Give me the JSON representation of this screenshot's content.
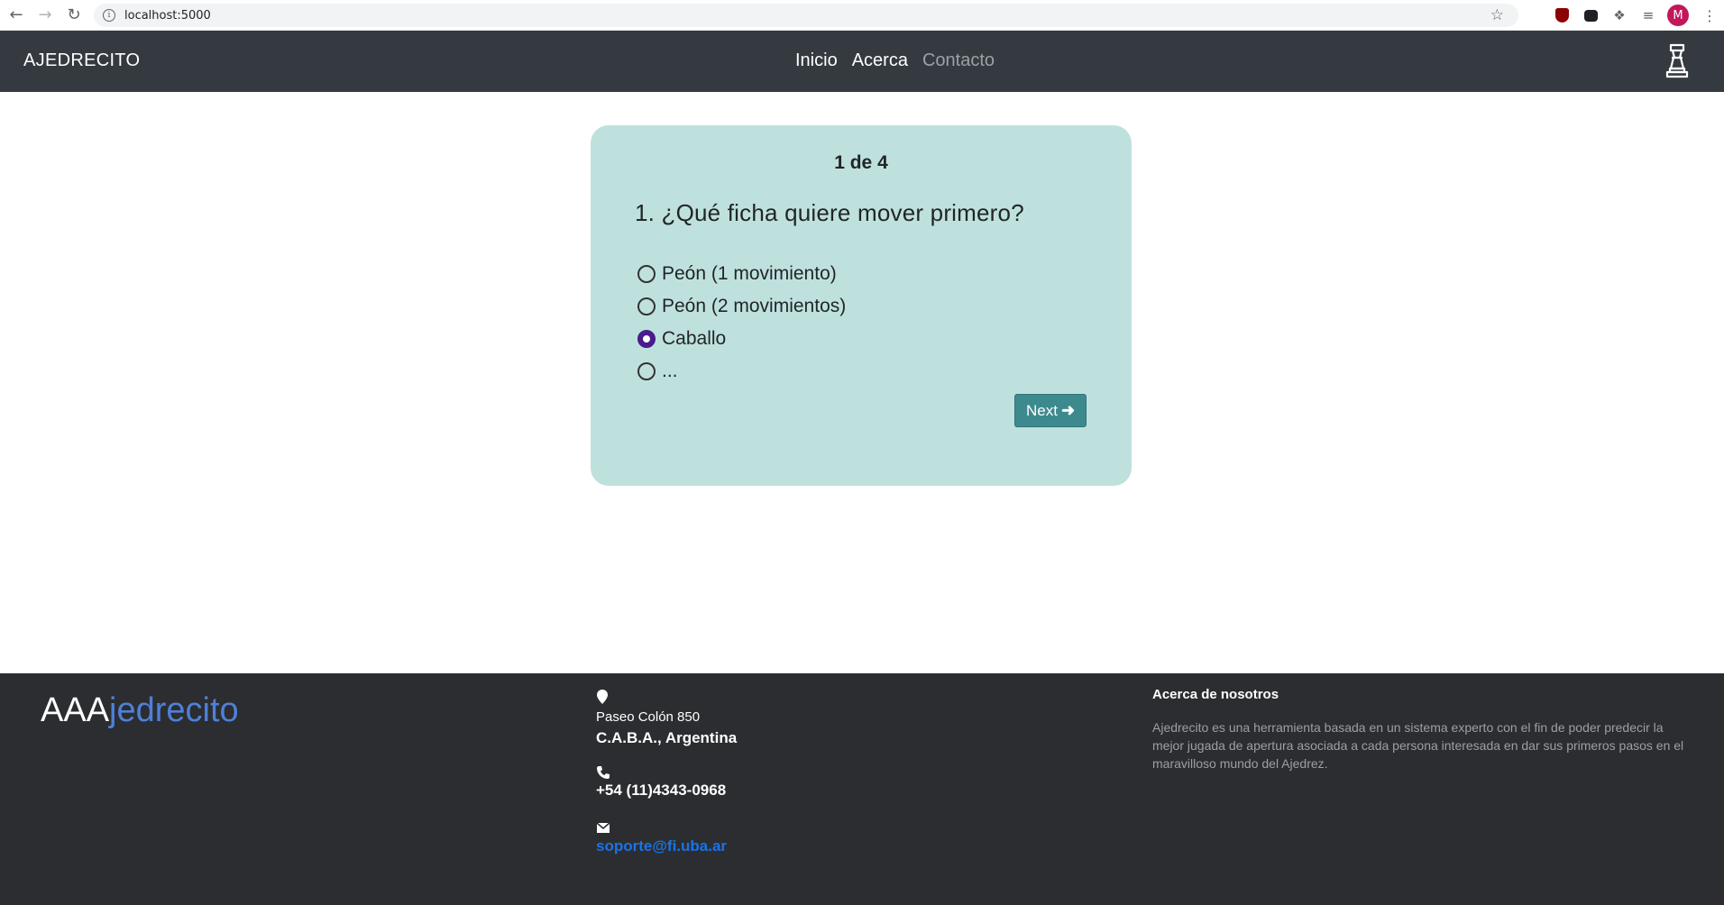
{
  "browser": {
    "url": "localhost:5000",
    "avatar_letter": "M"
  },
  "navbar": {
    "brand": "AJEDRECITO",
    "links": [
      {
        "label": "Inicio"
      },
      {
        "label": "Acerca"
      },
      {
        "label": "Contacto"
      }
    ]
  },
  "quiz": {
    "counter": "1 de 4",
    "question": "1. ¿Qué ficha quiere mover primero?",
    "options": [
      {
        "label": "Peón (1 movimiento)",
        "checked": false
      },
      {
        "label": "Peón (2 movimientos)",
        "checked": false
      },
      {
        "label": "Caballo",
        "checked": true
      },
      {
        "label": "...",
        "checked": false
      }
    ],
    "next_label": "Next",
    "card_color": "#bfe1de",
    "button_color": "#3d8a8e",
    "selected_color": "#4b1a8c"
  },
  "footer": {
    "logo_prefix": "AAA",
    "logo_suffix": "jedrecito",
    "address_line1": "Paseo Colón 850",
    "address_line2": "C.A.B.A., Argentina",
    "phone": "+54 (11)4343-0968",
    "email": "soporte@fi.uba.ar",
    "about_title": "Acerca de nosotros",
    "about_text": "Ajedrecito es una herramienta basada en un sistema experto con el fin de poder predecir la mejor jugada de apertura asociada a cada persona interesada en dar sus primeros pasos en el maravilloso mundo del Ajedrez.",
    "background_color": "#2b2d30",
    "logo_accent_color": "#4f80d8"
  }
}
